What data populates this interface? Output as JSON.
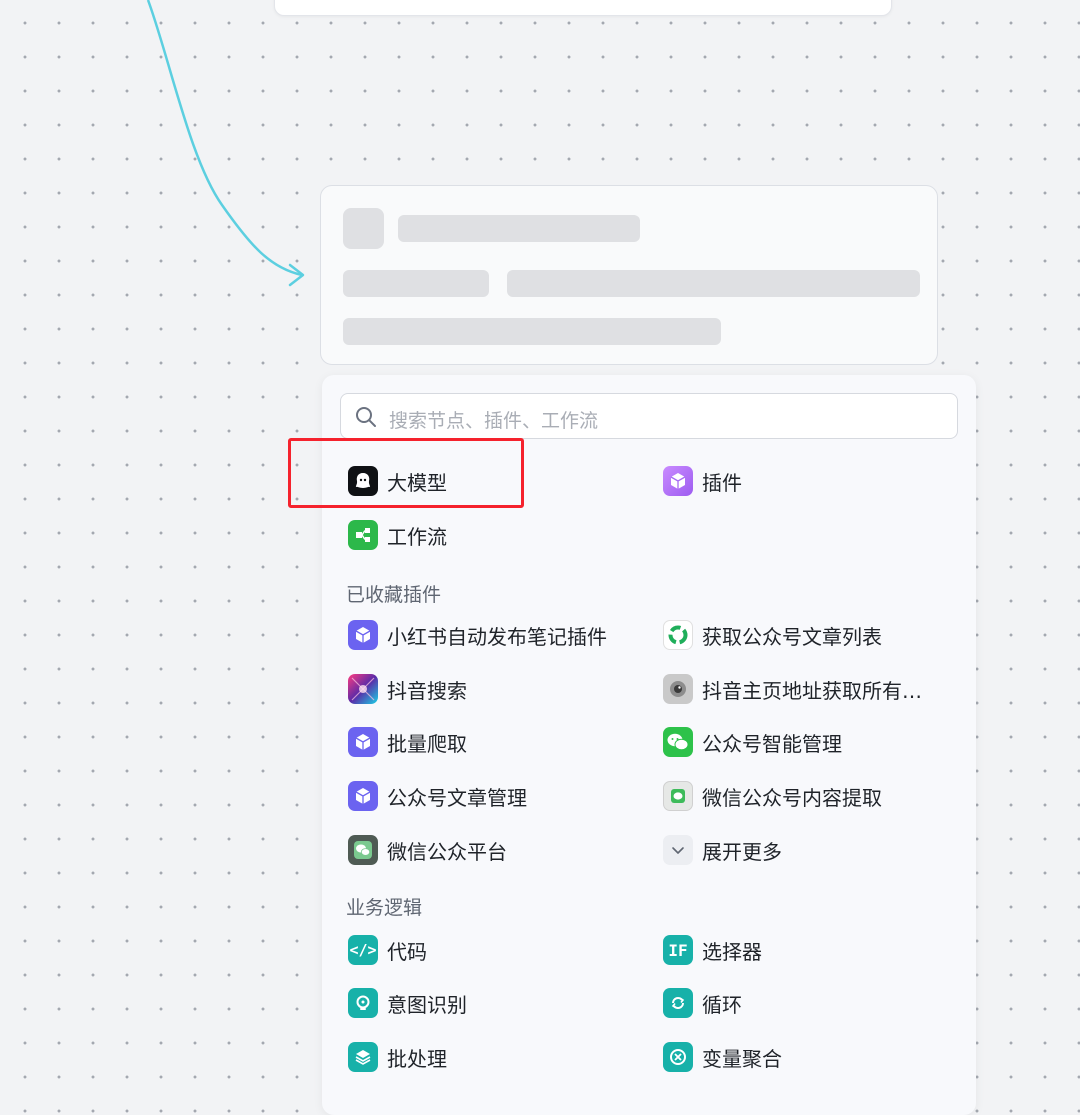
{
  "search": {
    "placeholder": "搜索节点、插件、工作流"
  },
  "basic_nodes": [
    {
      "label": "大模型",
      "icon": "llm-icon"
    },
    {
      "label": "插件",
      "icon": "plugin-cube-icon"
    },
    {
      "label": "工作流",
      "icon": "workflow-icon"
    }
  ],
  "favorites": {
    "title": "已收藏插件",
    "items": [
      {
        "label": "小红书自动发布笔记插件",
        "icon": "plugin-cube-icon"
      },
      {
        "label": "获取公众号文章列表",
        "icon": "green-ring-icon"
      },
      {
        "label": "抖音搜索",
        "icon": "douyin-search-icon"
      },
      {
        "label": "抖音主页地址获取所有…",
        "icon": "eye-icon"
      },
      {
        "label": "批量爬取",
        "icon": "plugin-cube-icon"
      },
      {
        "label": "公众号智能管理",
        "icon": "wechat-icon"
      },
      {
        "label": "公众号文章管理",
        "icon": "plugin-cube-icon"
      },
      {
        "label": "微信公众号内容提取",
        "icon": "wechat-gray-icon"
      },
      {
        "label": "微信公众平台",
        "icon": "wechat-dark-icon"
      },
      {
        "label": "展开更多",
        "icon": "chevron-down-icon"
      }
    ]
  },
  "business_logic": {
    "title": "业务逻辑",
    "items": [
      {
        "label": "代码",
        "icon": "code-icon"
      },
      {
        "label": "选择器",
        "icon": "if-selector-icon"
      },
      {
        "label": "意图识别",
        "icon": "intent-icon"
      },
      {
        "label": "循环",
        "icon": "loop-icon"
      },
      {
        "label": "批处理",
        "icon": "batch-icon"
      },
      {
        "label": "变量聚合",
        "icon": "variable-merge-icon"
      }
    ]
  },
  "colors": {
    "canvas_bg": "#f2f3f5",
    "edge": "#5ccfe0",
    "highlight": "#f5222d",
    "teal": "#17b1a9"
  }
}
